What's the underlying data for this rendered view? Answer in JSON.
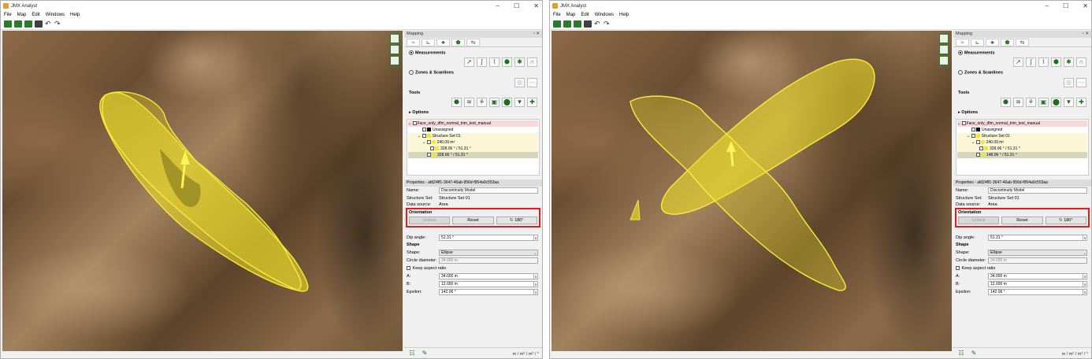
{
  "windows": [
    {
      "title": "JMX Analyst",
      "menu": [
        "File",
        "Map",
        "Edit",
        "Windows",
        "Help"
      ],
      "mapping_panel": {
        "title": "Mapping",
        "measurements_label": "Measurements",
        "zones_label": "Zones & Scanlines",
        "tools_label": "Tools",
        "options_label": "Options",
        "tree": {
          "root": "Face_only_dfm_normal_trim_test_manual",
          "unassigned": "Unassigned",
          "structure_set": "Structure Set 01",
          "area": "240.09 m²",
          "item1": "328.06 ° / 51.31 °",
          "item2": "328.06 ° / 51.31 °"
        }
      },
      "properties": {
        "header": "Properties - afd24ff1-3647-46ab-956d-f954a0c553aa",
        "name_label": "Name:",
        "name_value": "Discontinuity Model",
        "structure_set_label": "Structure Set:",
        "structure_set_value": "Structure Set 01",
        "data_source_label": "Data source:",
        "data_source_value": "Area",
        "orientation_title": "Orientation",
        "unlock_label": "Unlock",
        "reset_label": "Reset",
        "flip_label": "180°",
        "dip_angle_label": "Dip angle:",
        "dip_angle_value": "51.31 °",
        "shape_title": "Shape",
        "shape_label": "Shape:",
        "shape_value": "Ellipse",
        "circle_label": "Circle diameter:",
        "circle_value": "34.000 m",
        "keep_aspect_label": "Keep aspect ratio",
        "a_label": "A:",
        "a_value": "34.000 m",
        "b_label": "B:",
        "b_value": "12.000 m",
        "epsilon_label": "Epsilon:",
        "epsilon_value": "142.06 °"
      },
      "units": "m / m² / m³ / °"
    },
    {
      "title": "JMX Analyst",
      "menu": [
        "File",
        "Map",
        "Edit",
        "Windows",
        "Help"
      ],
      "mapping_panel": {
        "title": "Mapping",
        "measurements_label": "Measurements",
        "zones_label": "Zones & Scanlines",
        "tools_label": "Tools",
        "options_label": "Options",
        "tree": {
          "root": "Face_only_dfm_normal_trim_test_manual",
          "unassigned": "Unassigned",
          "structure_set": "Structure Set 01",
          "area": "240.09 m²",
          "item1": "328.06 ° / 51.31 °",
          "item2": "148.06 ° / 51.31 °"
        }
      },
      "properties": {
        "header": "Properties - afd24ff1-3647-46ab-956d-f954a0c553aa",
        "name_label": "Name:",
        "name_value": "Discontinuity Model",
        "structure_set_label": "Structure Set:",
        "structure_set_value": "Structure Set 01",
        "data_source_label": "Data source:",
        "data_source_value": "Area",
        "orientation_title": "Orientation",
        "unlock_label": "Unlock",
        "reset_label": "Reset",
        "flip_label": "180°",
        "dip_angle_label": "Dip angle:",
        "dip_angle_value": "51.31 °",
        "shape_title": "Shape",
        "shape_label": "Shape:",
        "shape_value": "Ellipse",
        "circle_label": "Circle diameter:",
        "circle_value": "34.000 m",
        "keep_aspect_label": "Keep aspect ratio",
        "a_label": "A:",
        "a_value": "34.000 m",
        "b_label": "B:",
        "b_value": "12.000 m",
        "epsilon_label": "Epsilon:",
        "epsilon_value": "142.06 °"
      },
      "units": "m / m² / m³ / °"
    }
  ],
  "colors": {
    "highlight": "#e41b1b",
    "overlay": "#f5e626",
    "accent": "#2c7a2c"
  }
}
